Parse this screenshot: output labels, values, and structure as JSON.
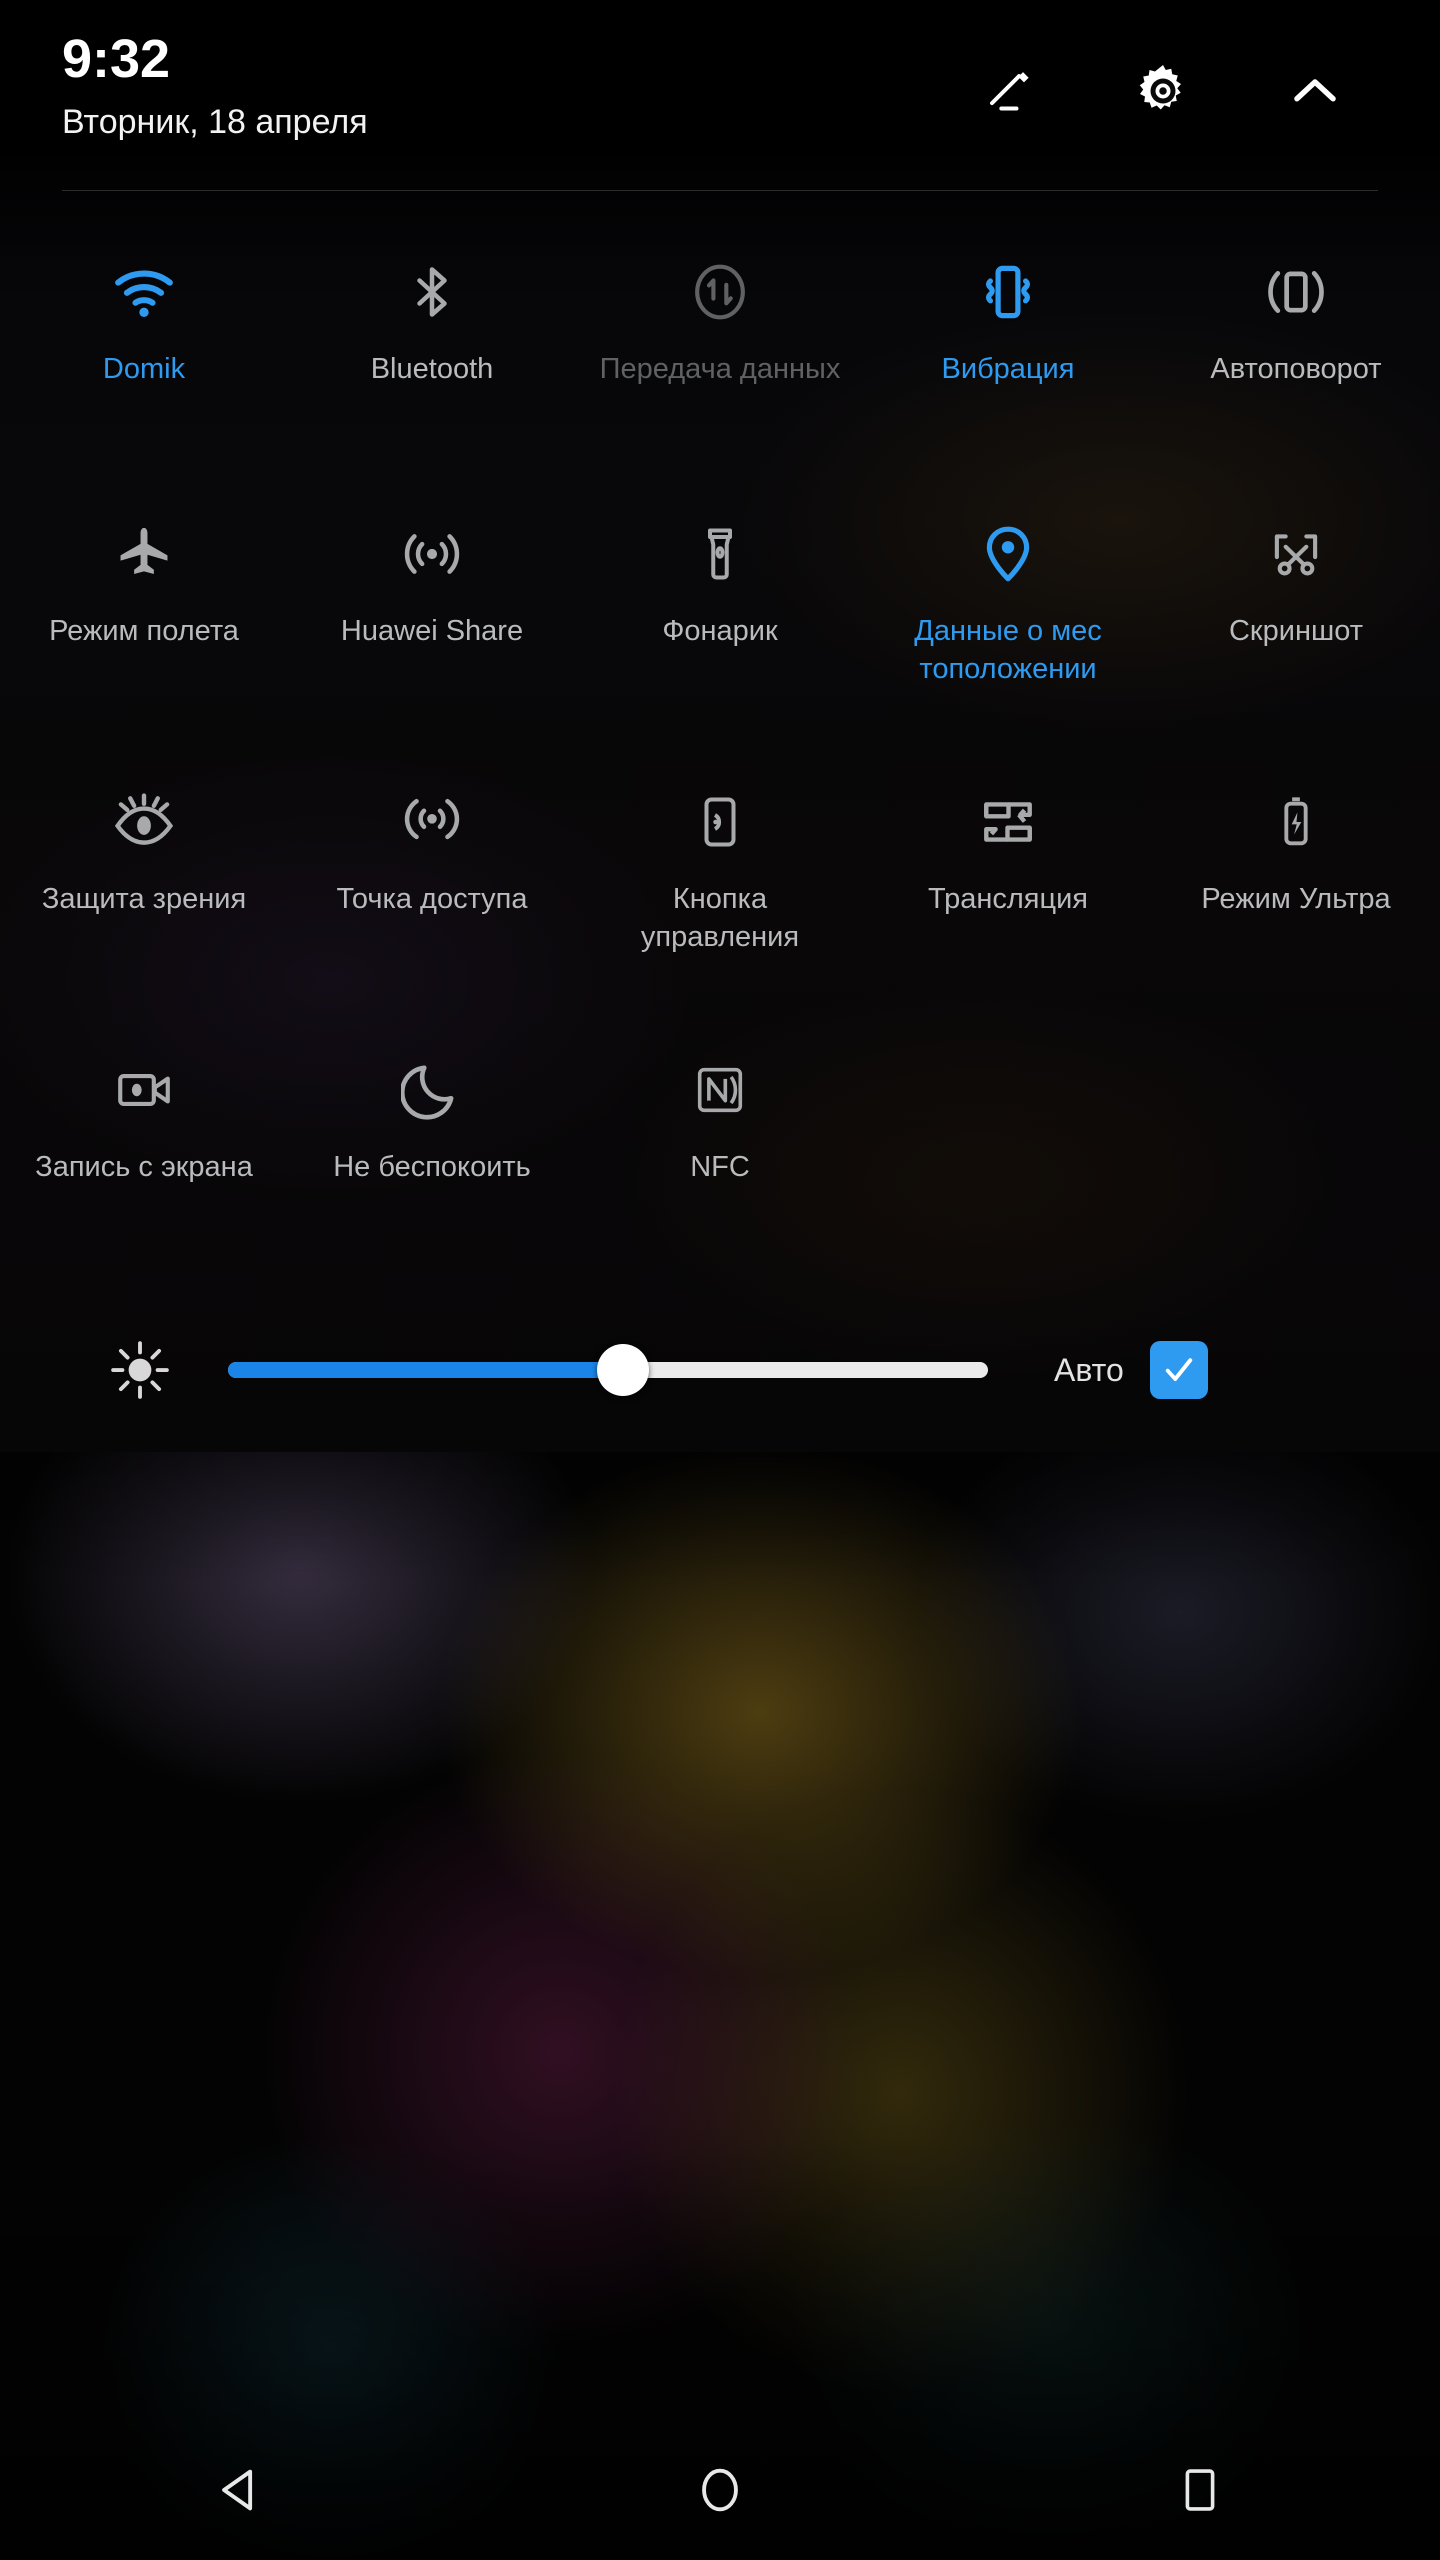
{
  "status": {
    "time": "9:32",
    "date": "Вторник, 18 апреля"
  },
  "header_actions": [
    {
      "name": "edit-icon",
      "label": "Изменить"
    },
    {
      "name": "gear-icon",
      "label": "Настройки"
    },
    {
      "name": "chevron-up-icon",
      "label": "Свернуть"
    }
  ],
  "colors": {
    "accent": "#2e9bf0",
    "slider_fill": "#1a84e8",
    "inactive_label": "#b9bbbd",
    "disabled_label": "#5f6164",
    "icon_inactive": "#a7a9ab",
    "text_primary": "#ffffff"
  },
  "tiles": [
    {
      "label": "Domik",
      "icon": "wifi-icon",
      "state": "active"
    },
    {
      "label": "Bluetooth",
      "icon": "bluetooth-icon",
      "state": "inactive"
    },
    {
      "label": "Передача данных",
      "icon": "mobile-data-icon",
      "state": "disabled"
    },
    {
      "label": "Вибрация",
      "icon": "vibration-icon",
      "state": "active"
    },
    {
      "label": "Автоповорот",
      "icon": "auto-rotate-icon",
      "state": "inactive"
    },
    {
      "label": "Режим полета",
      "icon": "airplane-icon",
      "state": "inactive"
    },
    {
      "label": "Huawei Share",
      "icon": "huawei-share-icon",
      "state": "inactive"
    },
    {
      "label": "Фонарик",
      "icon": "flashlight-icon",
      "state": "inactive"
    },
    {
      "label": "Данные о мес тоположении",
      "icon": "location-pin-icon",
      "state": "active"
    },
    {
      "label": "Скриншот",
      "icon": "screenshot-icon",
      "state": "inactive"
    },
    {
      "label": "Защита зрения",
      "icon": "eye-comfort-icon",
      "state": "inactive"
    },
    {
      "label": "Точка доступа",
      "icon": "hotspot-icon",
      "state": "inactive"
    },
    {
      "label": "Кнопка управления",
      "icon": "nav-dock-icon",
      "state": "inactive"
    },
    {
      "label": "Трансляция",
      "icon": "cast-icon",
      "state": "inactive"
    },
    {
      "label": "Режим Ультра",
      "icon": "ultra-battery-icon",
      "state": "inactive"
    },
    {
      "label": "Запись с экрана",
      "icon": "screen-record-icon",
      "state": "inactive"
    },
    {
      "label": "Не беспокоить",
      "icon": "moon-icon",
      "state": "inactive"
    },
    {
      "label": "NFC",
      "icon": "nfc-icon",
      "state": "inactive"
    }
  ],
  "brightness": {
    "icon": "brightness-icon",
    "value_percent": 52,
    "auto_label": "Авто",
    "auto_checked": true,
    "check_glyph": "✓"
  },
  "navbar": [
    {
      "name": "back-button",
      "label": "Назад"
    },
    {
      "name": "home-button",
      "label": "Главный экран"
    },
    {
      "name": "recents-button",
      "label": "Обзор"
    }
  ]
}
